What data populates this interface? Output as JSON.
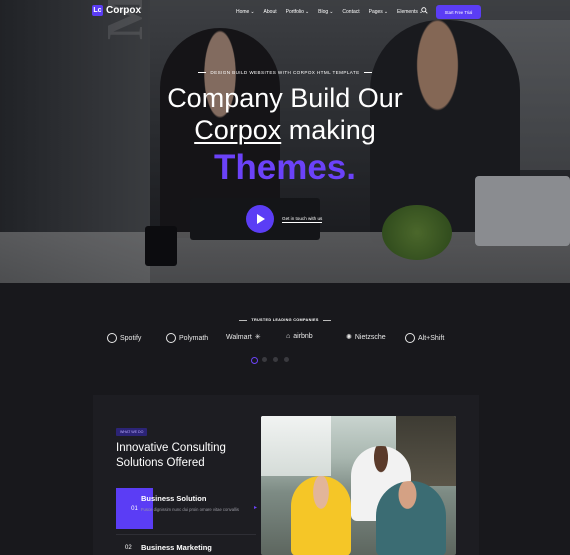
{
  "brand": {
    "logo_mark": "Lc",
    "name": "Corpox"
  },
  "nav": {
    "items": [
      {
        "label": "Home",
        "dropdown": true
      },
      {
        "label": "About",
        "dropdown": false
      },
      {
        "label": "Portfolio",
        "dropdown": true
      },
      {
        "label": "Blog",
        "dropdown": true
      },
      {
        "label": "Contact",
        "dropdown": false
      },
      {
        "label": "Pages",
        "dropdown": true
      },
      {
        "label": "Elements",
        "dropdown": true
      }
    ],
    "cta": "Start Free Trial",
    "search_icon": "search-icon"
  },
  "hero": {
    "tagline": "DESIGN BUILD WEBSITES WITH CORPOX HTML TEMPLATE",
    "line1": "Company Build Our",
    "line2_underlined": "Corpox",
    "line2_rest": " making",
    "line3": "Themes.",
    "play_label": "Get in touch with us",
    "wall_text": "Meetin"
  },
  "trusted": {
    "title": "TRUSTED LEADING COMPANIES",
    "brands": [
      "Spotify",
      "Polymath",
      "Walmart",
      "airbnb",
      "Nietzsche",
      "Alt+Shift"
    ]
  },
  "services": {
    "badge": "WHAT WE DO",
    "title_line1": "Innovative Consulting",
    "title_line2": "Solutions Offered",
    "items": [
      {
        "num": "01",
        "title": "Business Solution",
        "desc": "Fusce dignissim nunc dui proin ornare vitae convallis"
      },
      {
        "num": "02",
        "title": "Business Marketing",
        "desc": ""
      }
    ]
  },
  "colors": {
    "accent": "#5b3df5",
    "accent_text": "#6b42f8",
    "background": "#18181c",
    "card": "#1d1d22"
  }
}
